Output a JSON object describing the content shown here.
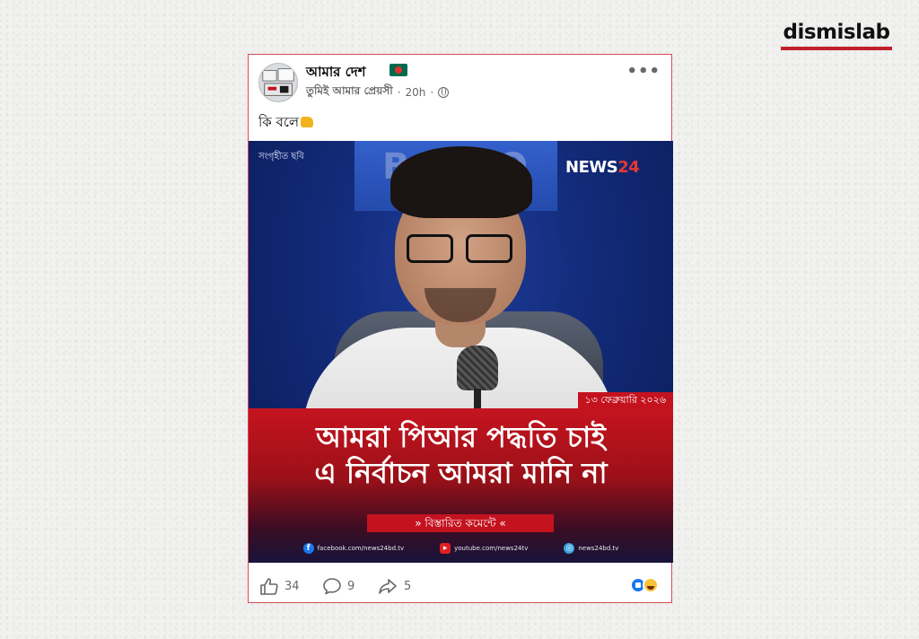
{
  "brand": {
    "name": "dismislab",
    "accent": "#c0222a"
  },
  "post": {
    "page_name": "আমার দেশ",
    "page_flag_icon": "bangladesh-flag",
    "author": "তুমিই আমার প্রেয়সী",
    "time": "20h",
    "separator": "·",
    "audience_icon": "globe",
    "more_label": "•••",
    "caption": "কি বলে",
    "caption_emoji": "folded-hands"
  },
  "media": {
    "collected_label": "সংগৃহীত ছবি",
    "logo_main": "NEWS",
    "logo_num": "24",
    "date": "১৩ ফেব্রুয়ারি ২০২৬",
    "headline_line1": "আমরা পিআর পদ্ধতি চাই",
    "headline_line2": "এ নির্বাচন আমরা মানি না",
    "details": "» বিস্তারিত কমেন্টে «",
    "social": [
      {
        "icon": "facebook-icon",
        "text": "facebook.com/news24bd.tv"
      },
      {
        "icon": "youtube-icon",
        "text": "youtube.com/news24tv"
      },
      {
        "icon": "web-icon",
        "text": "news24bd.tv"
      }
    ],
    "colors": {
      "primary_red": "#c4121f",
      "studio_blue": "#122a78"
    }
  },
  "actions": {
    "likes": "34",
    "comments": "9",
    "shares": "5",
    "reactions": [
      "like",
      "haha"
    ]
  }
}
